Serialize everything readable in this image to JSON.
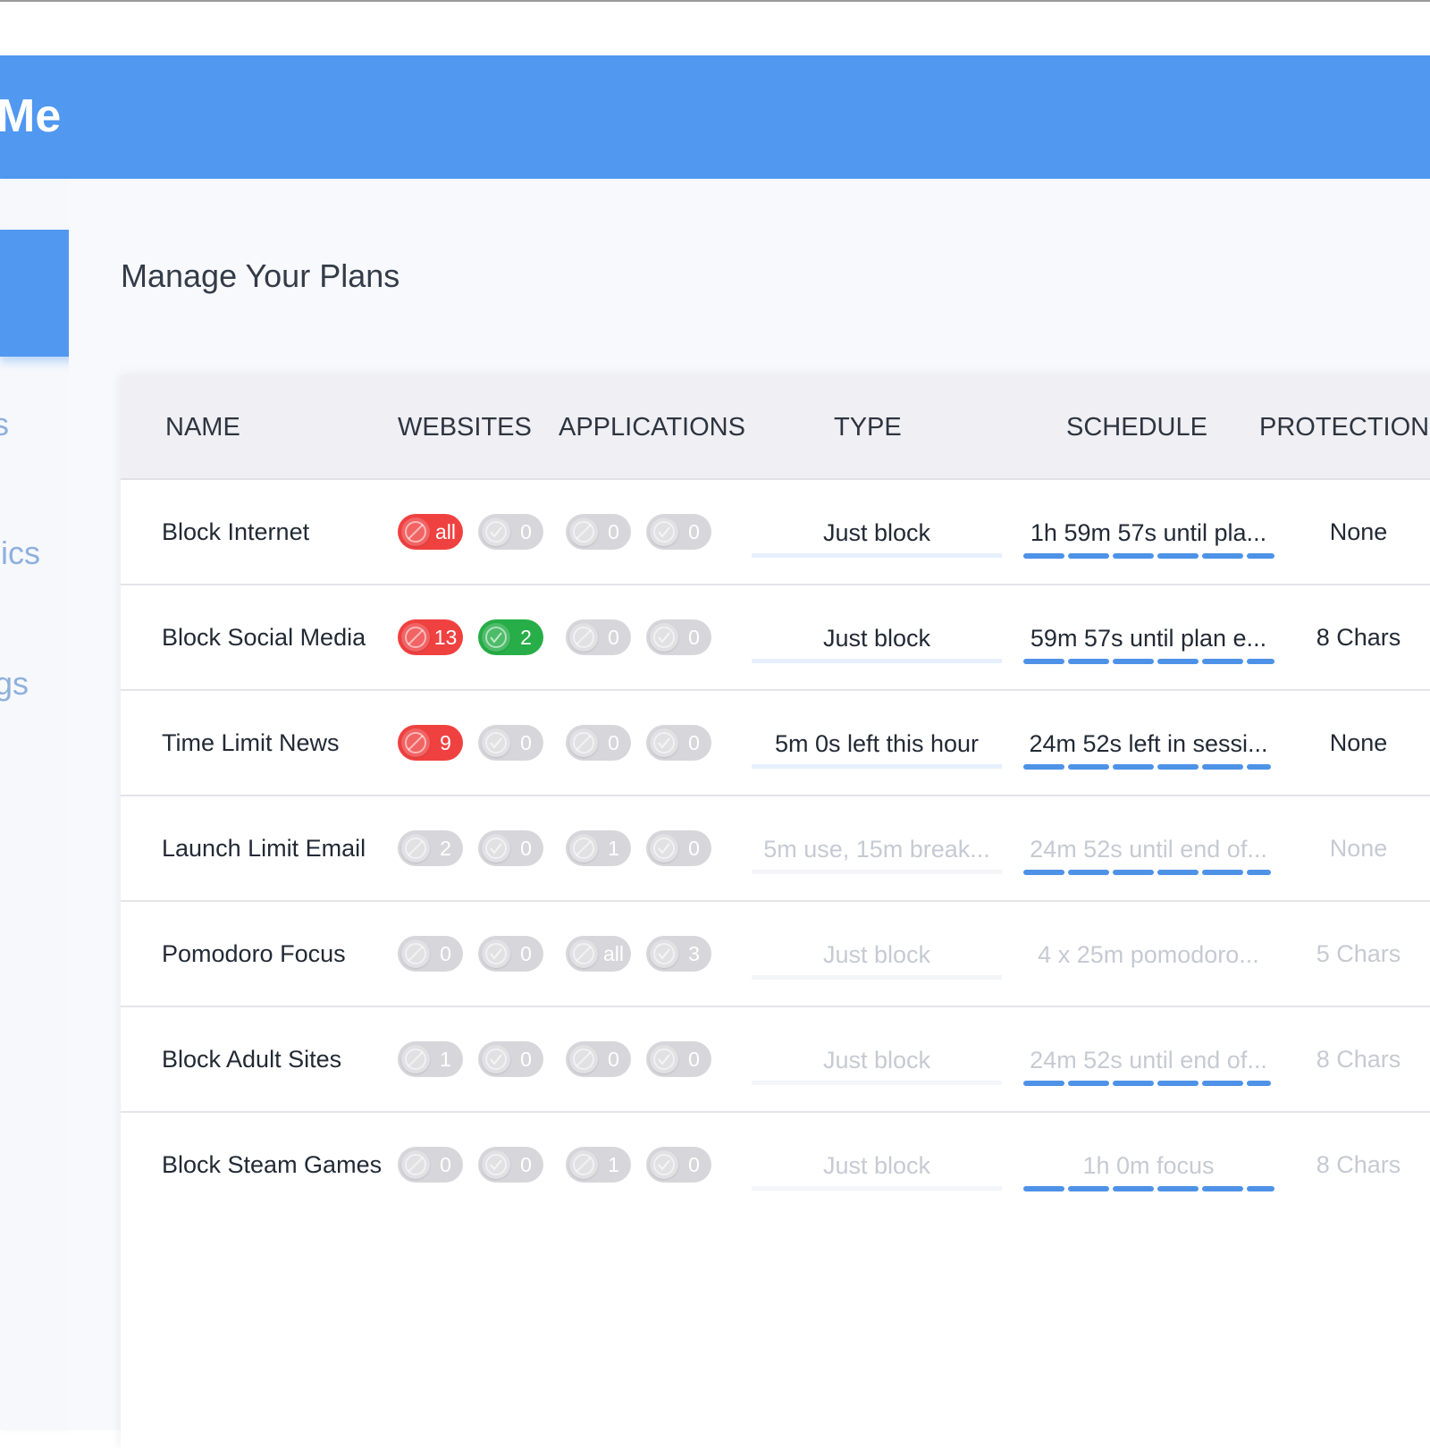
{
  "header": {
    "app_title": "Me"
  },
  "sidebar": {
    "items": [
      {
        "label": "s"
      },
      {
        "label": "ics"
      },
      {
        "label": "gs"
      }
    ]
  },
  "main": {
    "page_title": "Manage Your Plans"
  },
  "table": {
    "columns": [
      "NAME",
      "WEBSITES",
      "APPLICATIONS",
      "TYPE",
      "SCHEDULE",
      "PROTECTION"
    ],
    "rows": [
      {
        "name": "Block Internet",
        "badges": [
          {
            "value": "all",
            "color": "red",
            "icon": "block-icon"
          },
          {
            "value": "0",
            "color": "gray",
            "icon": "check-icon"
          },
          {
            "value": "0",
            "color": "gray",
            "icon": "block-icon"
          },
          {
            "value": "0",
            "color": "gray",
            "icon": "check-icon"
          }
        ],
        "type": "Just block",
        "schedule": "1h 59m 57s until pla...",
        "protection": "None",
        "active": true
      },
      {
        "name": "Block Social Media",
        "badges": [
          {
            "value": "13",
            "color": "red",
            "icon": "block-icon"
          },
          {
            "value": "2",
            "color": "green",
            "icon": "check-icon"
          },
          {
            "value": "0",
            "color": "gray",
            "icon": "block-icon"
          },
          {
            "value": "0",
            "color": "gray",
            "icon": "check-icon"
          }
        ],
        "type": "Just block",
        "schedule": "59m 57s until plan e...",
        "protection": "8 Chars",
        "active": true
      },
      {
        "name": "Time Limit News",
        "badges": [
          {
            "value": "9",
            "color": "red",
            "icon": "block-icon"
          },
          {
            "value": "0",
            "color": "gray",
            "icon": "check-icon"
          },
          {
            "value": "0",
            "color": "gray",
            "icon": "block-icon"
          },
          {
            "value": "0",
            "color": "gray",
            "icon": "check-icon"
          }
        ],
        "type": "5m 0s left this hour",
        "schedule": "24m 52s left in sessi...",
        "protection": "None",
        "active": true
      },
      {
        "name": "Launch Limit Email",
        "badges": [
          {
            "value": "2",
            "color": "gray",
            "icon": "block-icon"
          },
          {
            "value": "0",
            "color": "gray",
            "icon": "check-icon"
          },
          {
            "value": "1",
            "color": "gray",
            "icon": "block-icon"
          },
          {
            "value": "0",
            "color": "gray",
            "icon": "check-icon"
          }
        ],
        "type": "5m use, 15m break...",
        "schedule": "24m 52s until end of...",
        "protection": "None",
        "active": false
      },
      {
        "name": "Pomodoro Focus",
        "badges": [
          {
            "value": "0",
            "color": "gray",
            "icon": "block-icon"
          },
          {
            "value": "0",
            "color": "gray",
            "icon": "check-icon"
          },
          {
            "value": "all",
            "color": "gray",
            "icon": "block-icon"
          },
          {
            "value": "3",
            "color": "gray",
            "icon": "check-icon"
          }
        ],
        "type": "Just block",
        "schedule": "4 x 25m pomodoro...",
        "protection": "5 Chars",
        "active": false
      },
      {
        "name": "Block Adult Sites",
        "badges": [
          {
            "value": "1",
            "color": "gray",
            "icon": "block-icon"
          },
          {
            "value": "0",
            "color": "gray",
            "icon": "check-icon"
          },
          {
            "value": "0",
            "color": "gray",
            "icon": "block-icon"
          },
          {
            "value": "0",
            "color": "gray",
            "icon": "check-icon"
          }
        ],
        "type": "Just block",
        "schedule": "24m 52s until end of...",
        "protection": "8 Chars",
        "active": false
      },
      {
        "name": "Block Steam Games",
        "badges": [
          {
            "value": "0",
            "color": "gray",
            "icon": "block-icon"
          },
          {
            "value": "0",
            "color": "gray",
            "icon": "check-icon"
          },
          {
            "value": "1",
            "color": "gray",
            "icon": "block-icon"
          },
          {
            "value": "0",
            "color": "gray",
            "icon": "check-icon"
          }
        ],
        "type": "Just block",
        "schedule": "1h 0m focus",
        "protection": "8 Chars",
        "active": false
      }
    ]
  },
  "colors": {
    "accent": "#5098f0",
    "block_red": "#f04141",
    "allow_green": "#27ae48",
    "inactive_gray": "#d7d7db",
    "schedule_bar": "#4e92e8"
  }
}
